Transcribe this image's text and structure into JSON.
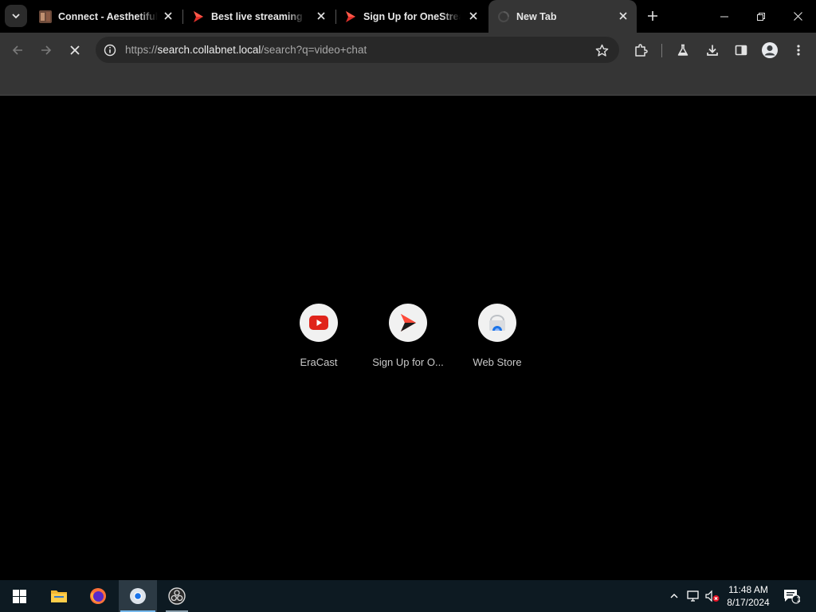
{
  "browser": {
    "tabs": [
      {
        "title": "Connect - Aesthetiful",
        "favicon": "image-thumbnail-icon",
        "active": false
      },
      {
        "title": "Best live streaming pl",
        "favicon": "red-play-icon",
        "active": false
      },
      {
        "title": "Sign Up for OneStream",
        "favicon": "red-play-icon",
        "active": false
      },
      {
        "title": "New Tab",
        "favicon": "loading-spinner-icon",
        "active": true
      }
    ],
    "toolbar": {
      "url_scheme": "https://",
      "url_host": "search.collabnet.local",
      "url_path": "/search?q=video+chat",
      "loading": true
    }
  },
  "new_tab": {
    "shortcuts": [
      {
        "label": "EraCast",
        "icon": "youtube-icon"
      },
      {
        "label": "Sign Up for O...",
        "icon": "red-play-icon"
      },
      {
        "label": "Web Store",
        "icon": "web-store-icon"
      }
    ]
  },
  "taskbar": {
    "apps": [
      {
        "name": "start",
        "icon": "windows-start-icon"
      },
      {
        "name": "file-explorer",
        "icon": "folder-icon"
      },
      {
        "name": "firefox",
        "icon": "firefox-icon"
      },
      {
        "name": "chrome",
        "icon": "chrome-icon",
        "active": true
      },
      {
        "name": "obs",
        "icon": "obs-icon"
      }
    ],
    "clock_time": "11:48 AM",
    "clock_date": "8/17/2024",
    "notification_count": "1"
  },
  "colors": {
    "tab_active_bg": "#353535",
    "toolbar_bg": "#353535",
    "omnibox_bg": "#282828",
    "content_bg": "#000000",
    "taskbar_bg": "#0d1a22",
    "accent": "#76b9ed"
  }
}
